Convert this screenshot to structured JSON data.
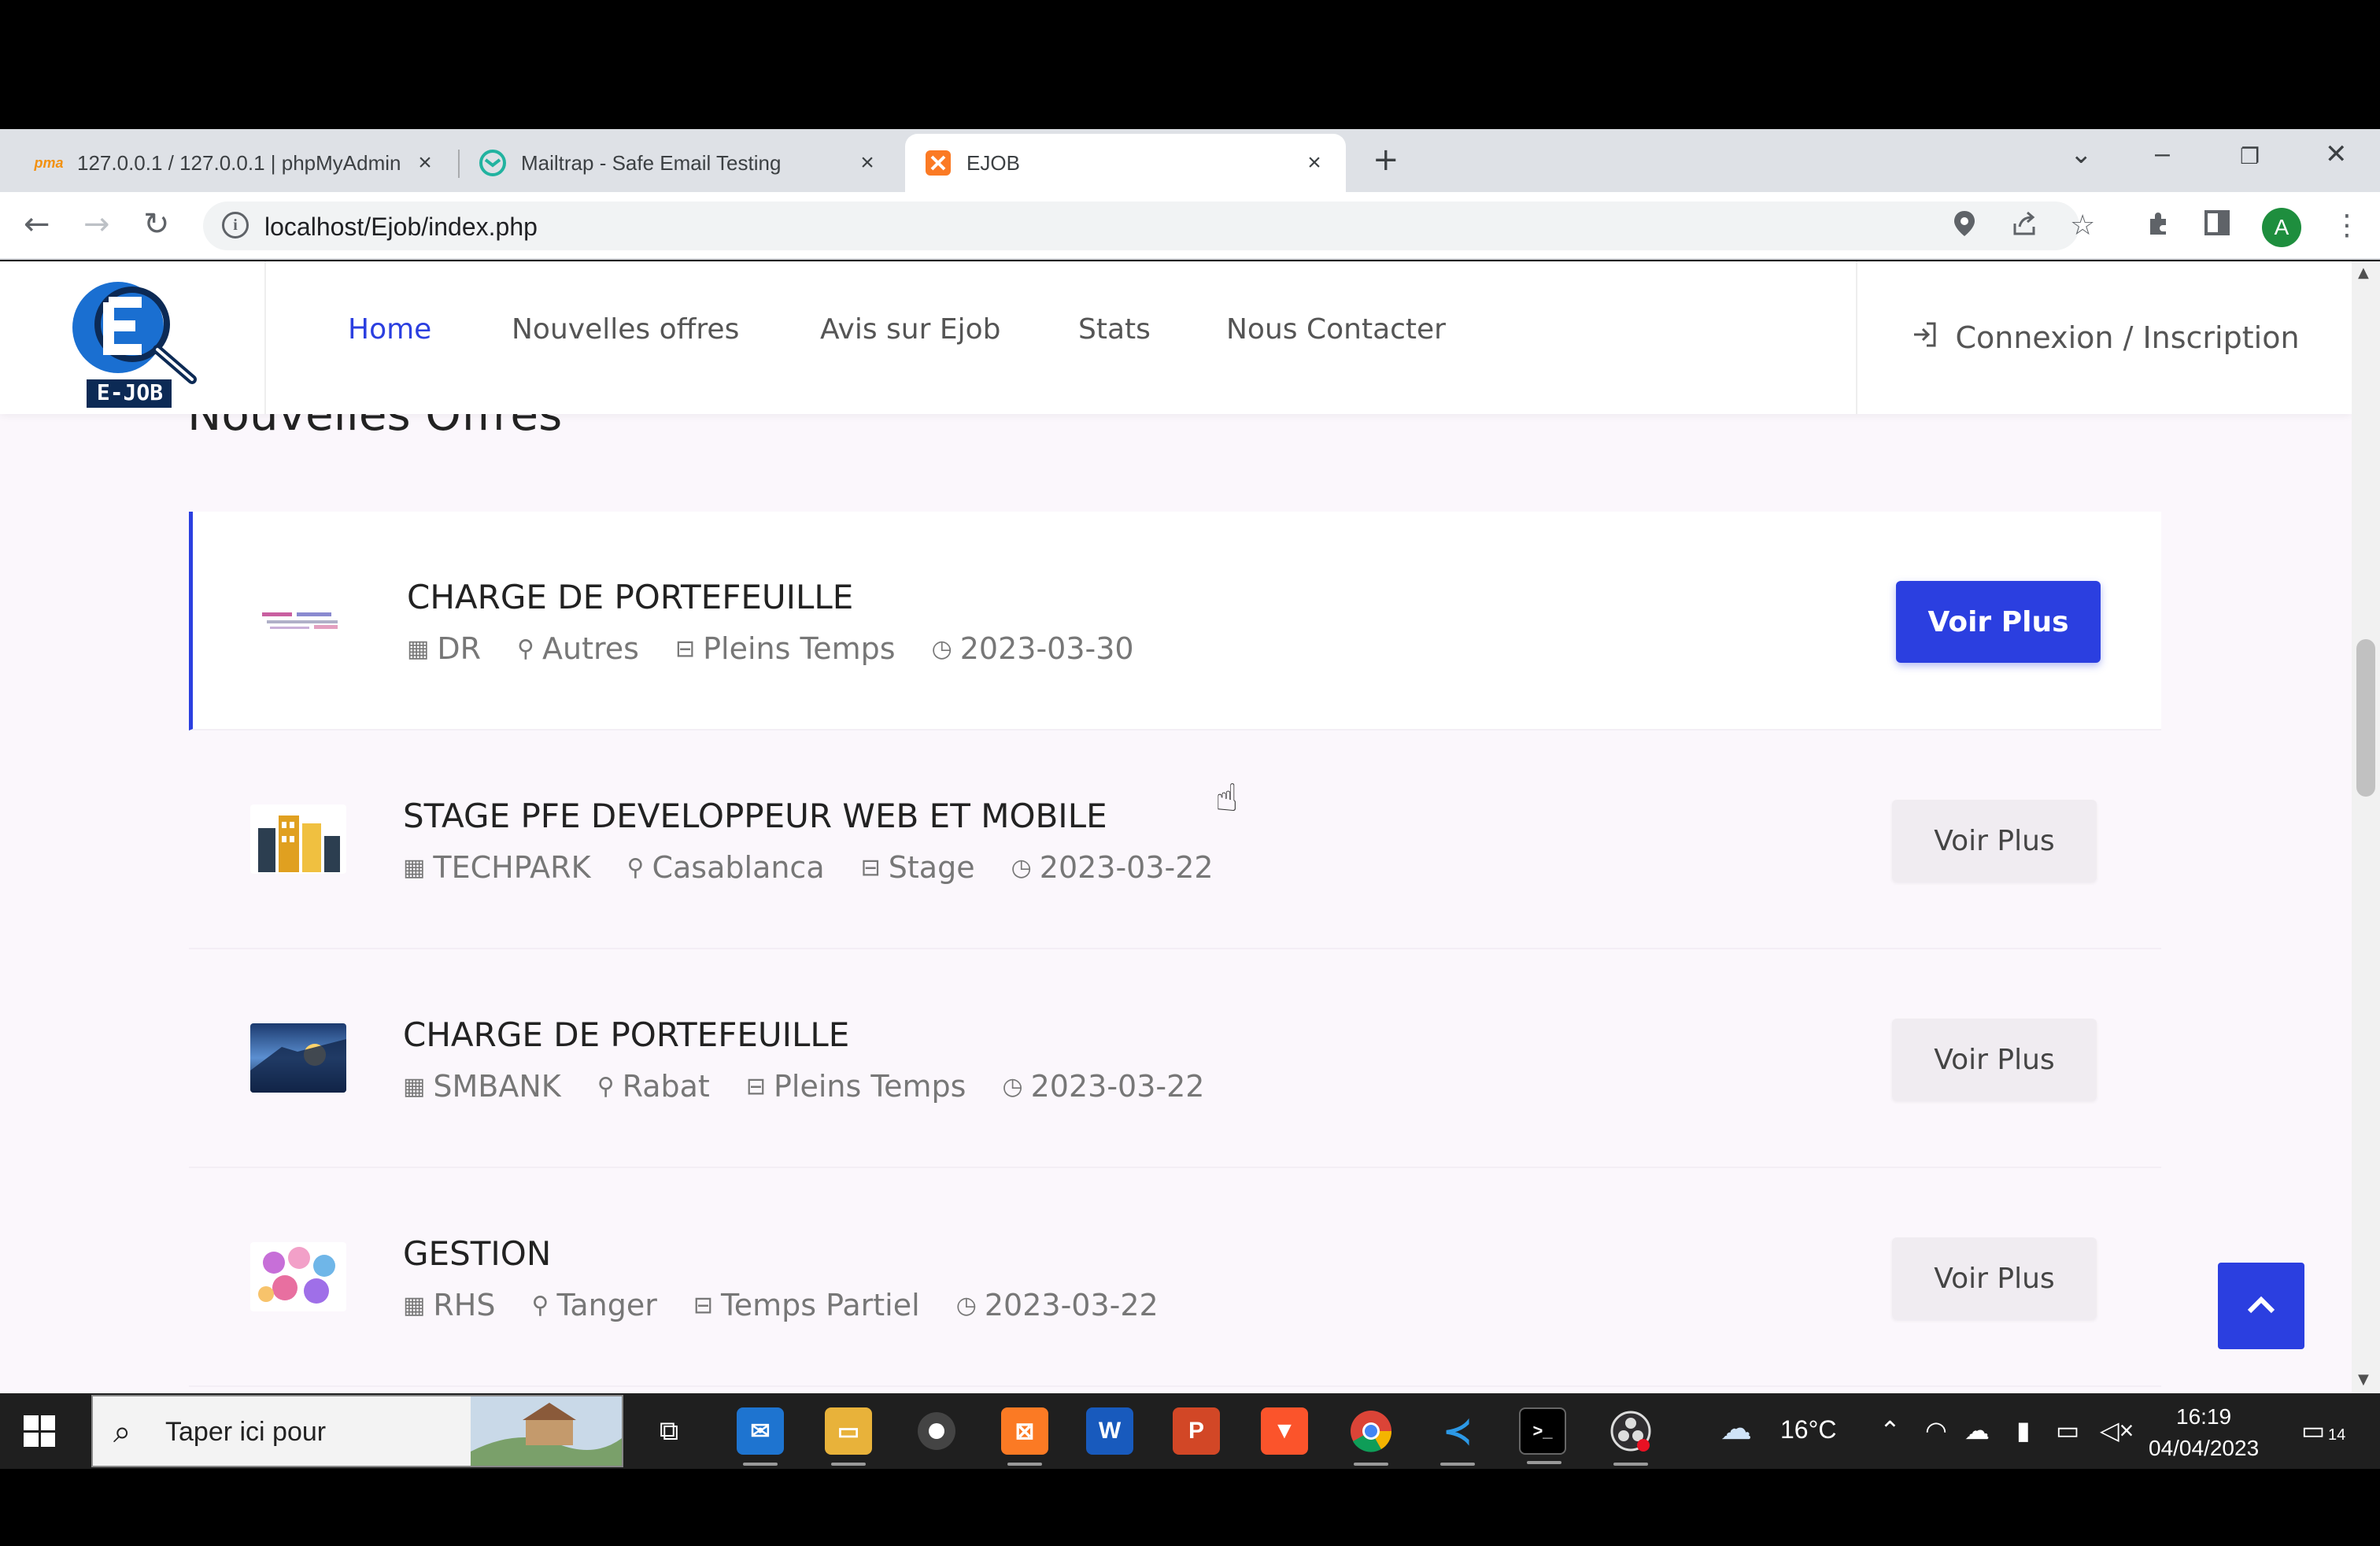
{
  "browser": {
    "tabs": [
      {
        "title": "127.0.0.1 / 127.0.0.1 | phpMyAdmin",
        "icon": "phpmyadmin-icon"
      },
      {
        "title": "Mailtrap - Safe Email Testing",
        "icon": "mailtrap-icon"
      },
      {
        "title": "EJOB",
        "icon": "xampp-icon",
        "active": true
      }
    ],
    "url": "localhost/Ejob/index.php",
    "profile_initial": "A"
  },
  "site": {
    "logo_text": "E-JOB",
    "nav": [
      {
        "label": "Home",
        "active": true
      },
      {
        "label": "Nouvelles offres"
      },
      {
        "label": "Avis sur Ejob"
      },
      {
        "label": "Stats"
      },
      {
        "label": "Nous Contacter"
      }
    ],
    "login_label": "Connexion / Inscription",
    "section_title": "Nouvelles Offres",
    "button_label": "Voir Plus",
    "jobs": [
      {
        "title": "CHARGE DE PORTEFEUILLE",
        "company": "DR",
        "location": "Autres",
        "type": "Pleins Temps",
        "date": "2023-03-30",
        "thumb": "document-thumbnail"
      },
      {
        "title": "STAGE PFE DEVELOPPEUR WEB ET MOBILE",
        "company": "TECHPARK",
        "location": "Casablanca",
        "type": "Stage",
        "date": "2023-03-22",
        "thumb": "buildings-thumbnail"
      },
      {
        "title": "CHARGE DE PORTEFEUILLE",
        "company": "SMBANK",
        "location": "Rabat",
        "type": "Pleins Temps",
        "date": "2023-03-22",
        "thumb": "city-sunset-thumbnail"
      },
      {
        "title": "GESTION",
        "company": "RHS",
        "location": "Tanger",
        "type": "Temps Partiel",
        "date": "2023-03-22",
        "thumb": "team-thumbnail"
      }
    ]
  },
  "taskbar": {
    "search_placeholder": "Taper ici pour",
    "weather": "16°C",
    "time": "16:19",
    "date": "04/04/2023",
    "notifications": "14"
  },
  "colors": {
    "accent": "#2b3fe0",
    "page_bg": "#fbf7fc"
  }
}
